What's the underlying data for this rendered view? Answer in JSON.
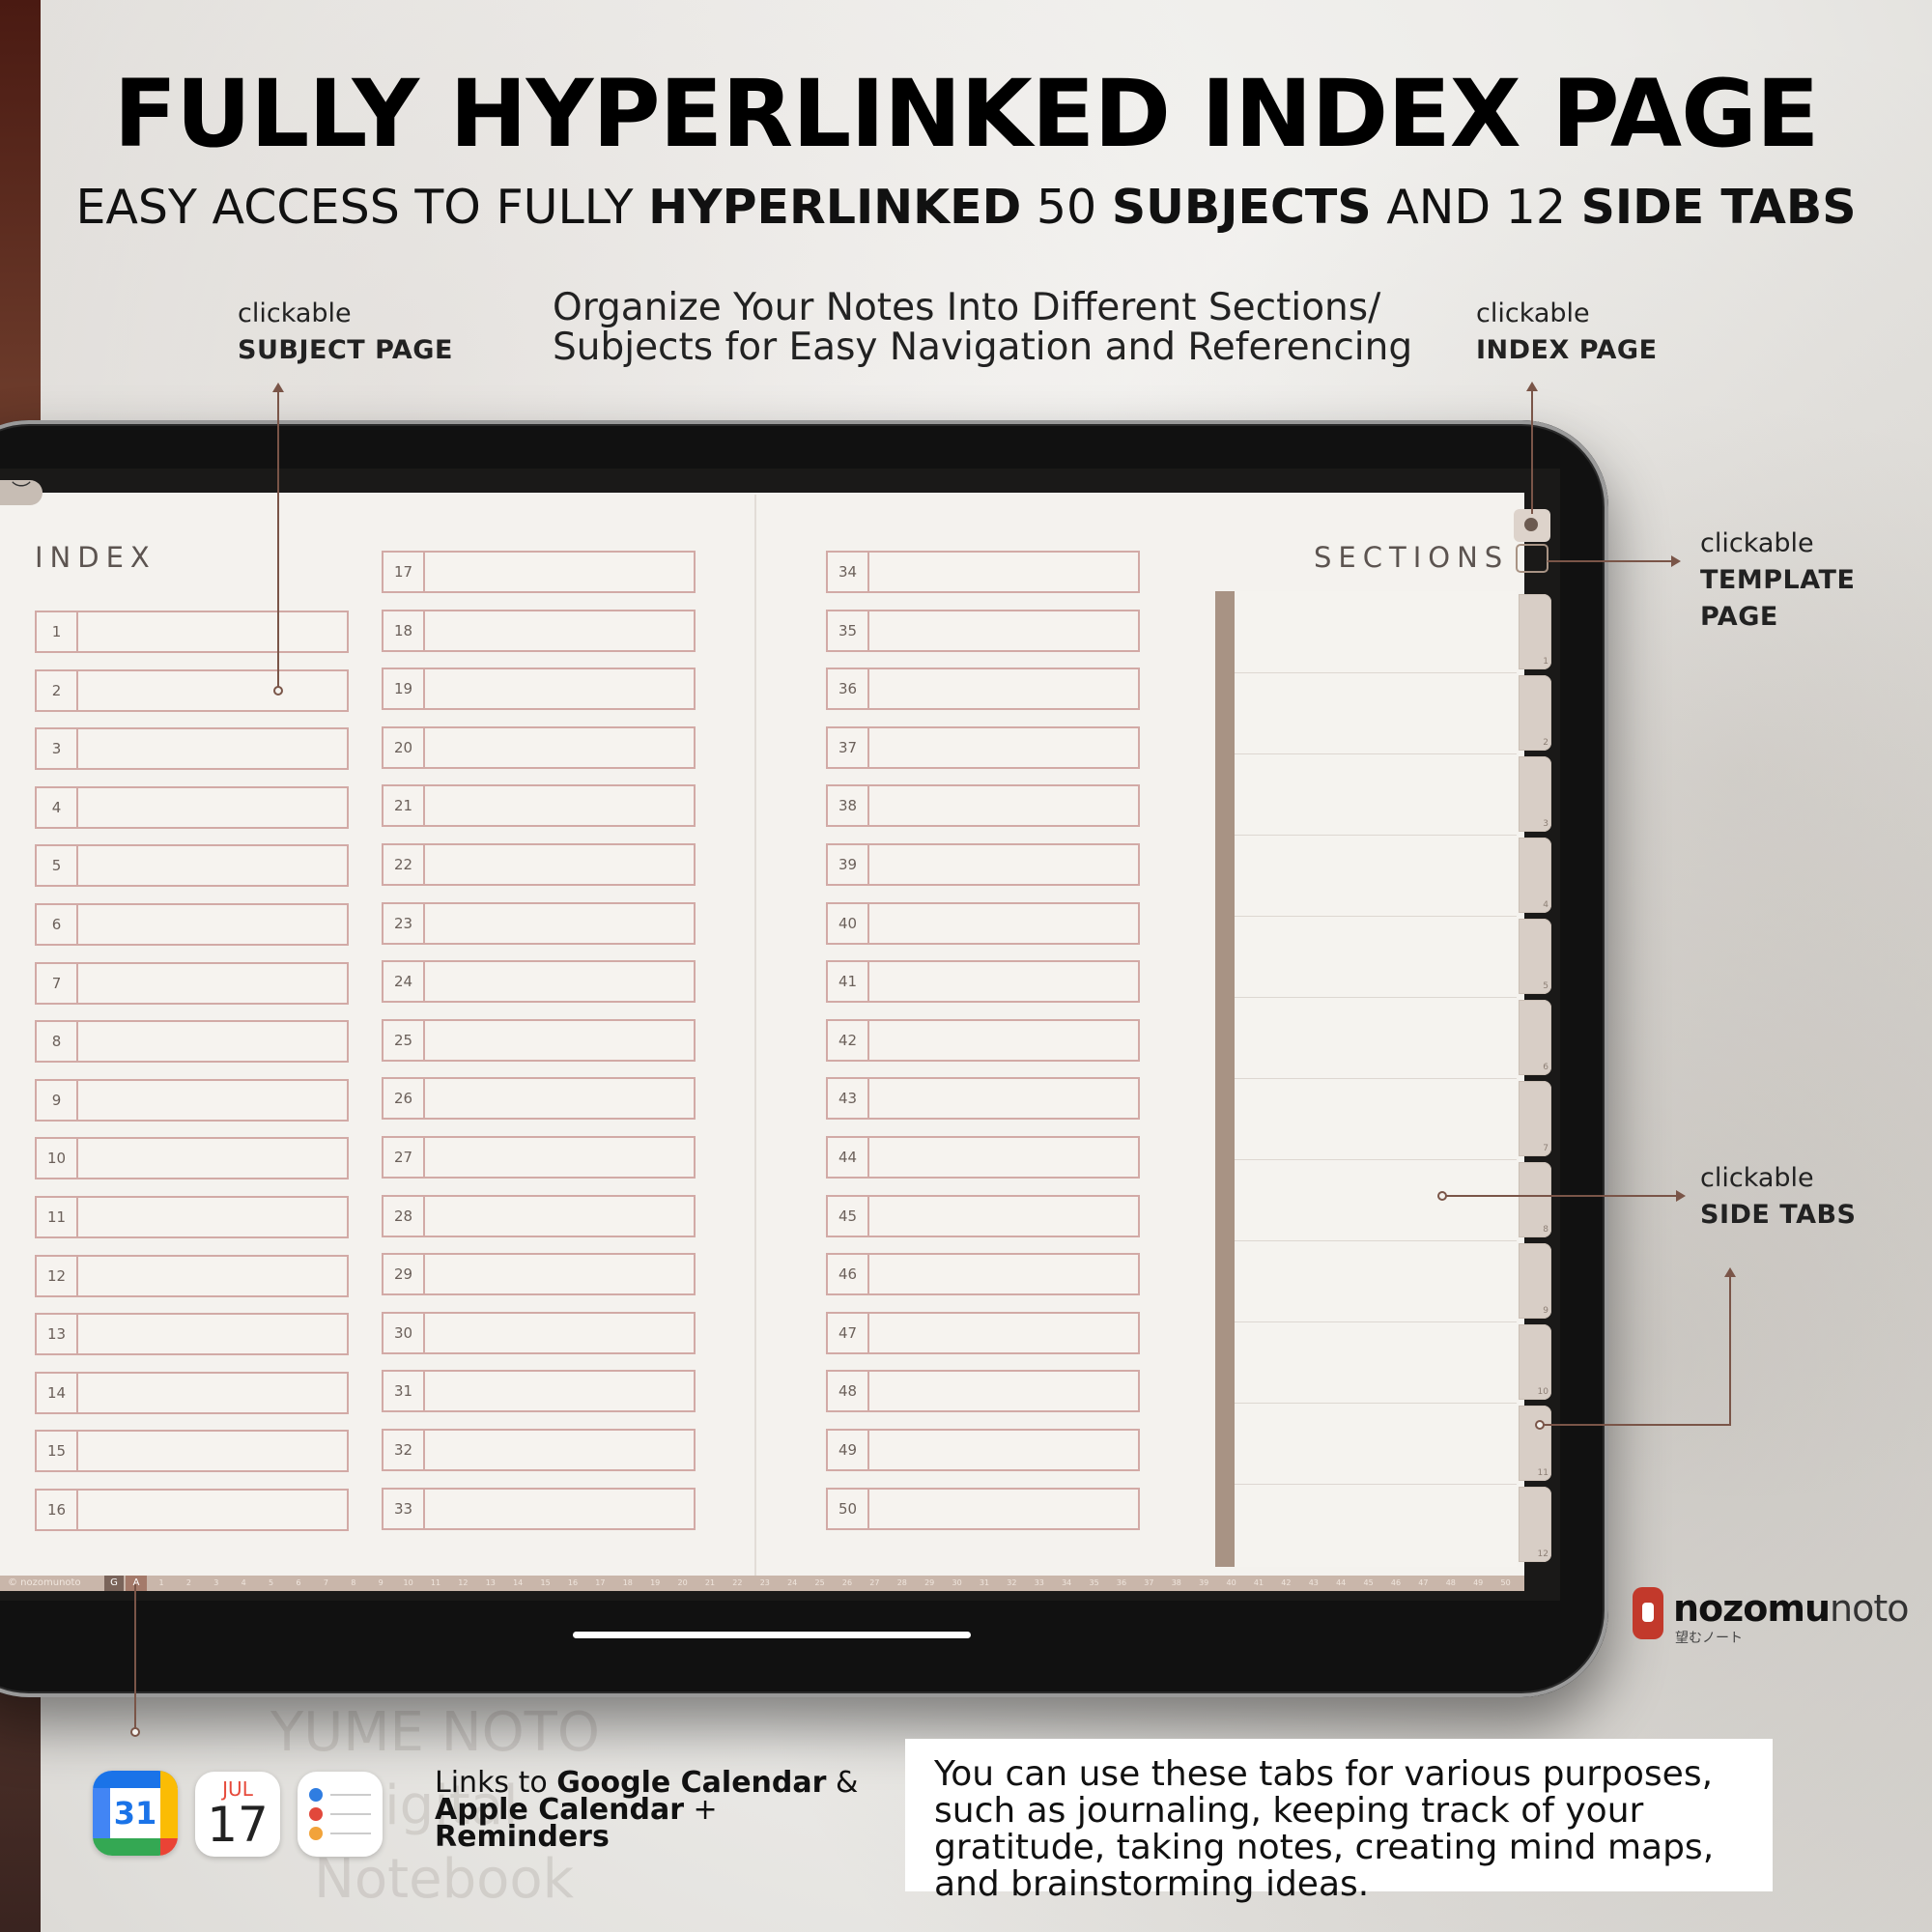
{
  "header": {
    "title": "FULLY HYPERLINKED INDEX PAGE",
    "subtitle_parts": {
      "p1": "EASY ACCESS TO FULLY ",
      "b1": "HYPERLINKED",
      "p2": " 50 ",
      "b2": "SUBJECTS",
      "p3": " AND 12 ",
      "b3": "SIDE TABS"
    }
  },
  "callouts": {
    "subject": {
      "small": "clickable",
      "bold": "SUBJECT PAGE"
    },
    "index": {
      "small": "clickable",
      "bold": "INDEX PAGE"
    },
    "template": {
      "small": "clickable",
      "bold1": "TEMPLATE",
      "bold2": "PAGE"
    },
    "sidetabs": {
      "small": "clickable",
      "bold": "SIDE TABS"
    },
    "organize_line1": "Organize Your Notes Into Different Sections/",
    "organize_line2": "Subjects for Easy Navigation and Referencing"
  },
  "notebook": {
    "index_heading": "INDEX",
    "sections_heading": "SECTIONS",
    "pull_tab_glyph": "︶",
    "subjects": [
      "1",
      "2",
      "3",
      "4",
      "5",
      "6",
      "7",
      "8",
      "9",
      "10",
      "11",
      "12",
      "13",
      "14",
      "15",
      "16",
      "17",
      "18",
      "19",
      "20",
      "21",
      "22",
      "23",
      "24",
      "25",
      "26",
      "27",
      "28",
      "29",
      "30",
      "31",
      "32",
      "33",
      "34",
      "35",
      "36",
      "37",
      "38",
      "39",
      "40",
      "41",
      "42",
      "43",
      "44",
      "45",
      "46",
      "47",
      "48",
      "49",
      "50"
    ],
    "side_tabs": [
      "1",
      "2",
      "3",
      "4",
      "5",
      "6",
      "7",
      "8",
      "9",
      "10",
      "11",
      "12"
    ],
    "footer": {
      "brand": "© nozomunoto",
      "g_label": "G",
      "a_label": "A"
    }
  },
  "apps": {
    "gcal_number": "31",
    "acal_month": "JUL",
    "acal_day": "17",
    "links_parts": {
      "p1": "Links to ",
      "b1": "Google Calendar",
      "p2": " &",
      "b2": "Apple Calendar",
      "p3": " +",
      "b3": "Reminders"
    }
  },
  "note": "You can use these tabs for various purposes, such as journaling, keeping track of your gratitude, taking notes, creating mind maps, and brainstorming ideas.",
  "logo": {
    "name_bold": "nozomu",
    "name_light": "noto",
    "jp": "望むノート"
  },
  "watermark": {
    "line1": "YUME NOTO",
    "line2": "Digital",
    "line3": "Notebook"
  },
  "colors": {
    "accent": "#7a5548",
    "row_border": "#d2aaa6",
    "section_bar": "#a89384",
    "page_bg": "#f4f2ee"
  }
}
